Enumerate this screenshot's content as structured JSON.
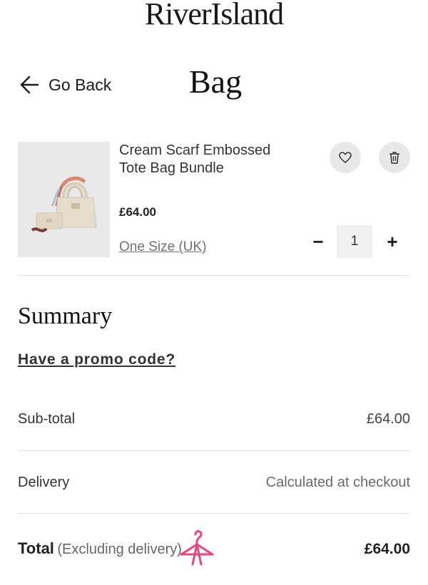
{
  "brand": {
    "logo_text": "RiverIsland"
  },
  "header": {
    "back_label": "Go Back",
    "title": "Bag"
  },
  "bag": {
    "items": [
      {
        "name": "Cream Scarf Embossed Tote Bag Bundle",
        "price": "£64.00",
        "size": "One Size (UK)",
        "quantity": "1",
        "qty_minus": "−",
        "qty_plus": "+"
      }
    ]
  },
  "summary": {
    "title": "Summary",
    "promo_label": "Have a promo code?",
    "subtotal_label": "Sub-total",
    "subtotal_value": "£64.00",
    "delivery_label": "Delivery",
    "delivery_value": "Calculated at checkout",
    "total_label": "Total",
    "total_note": "(Excluding delivery)",
    "total_value": "£64.00"
  },
  "icons": {
    "back": "arrow-left-icon",
    "wishlist": "heart-icon",
    "delete": "trash-icon",
    "floating": "hanger-icon"
  },
  "colors": {
    "text": "#222222",
    "muted": "#707070",
    "button_bg": "#e8e8e8",
    "accent_pink": "#e8457a"
  }
}
